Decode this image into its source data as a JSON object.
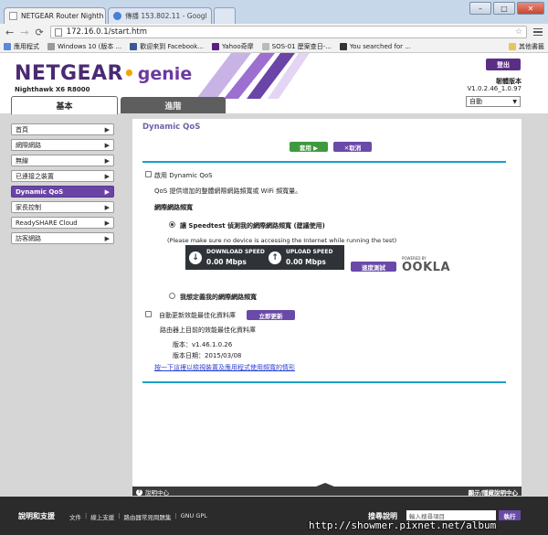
{
  "browser": {
    "tabs": [
      {
        "title": "NETGEAR Router Nighth",
        "close": "×",
        "icon_color": "#ffffff"
      },
      {
        "title": "傳播 153.802.11 - Googl",
        "close": "×",
        "icon_color": "#4a7fd8"
      }
    ],
    "window_buttons": {
      "minimize": "–",
      "maximize": "□",
      "close": "✕"
    },
    "url": "172.16.0.1/start.htm",
    "bookmarks": [
      {
        "label": "應用程式",
        "icon_color": "#5a8bd8"
      },
      {
        "label": "Windows 10 (版本 ...",
        "icon_color": "#9a9a9a"
      },
      {
        "label": "歡迎來到 Facebook...",
        "icon_color": "#3b5998"
      },
      {
        "label": "Yahoo奇摩",
        "icon_color": "#5b1e86"
      },
      {
        "label": "SOS-01 歷案查日-...",
        "icon_color": "#bbbbbb"
      },
      {
        "label": "You searched for ...",
        "icon_color": "#333333"
      }
    ],
    "other_bookmarks": "其他書籤"
  },
  "router": {
    "brand": "NETGEAR",
    "product": "genie",
    "model": "Nighthawk X6 R8000",
    "logout": "登出",
    "firmware_label": "韌體版本",
    "firmware_version": "V1.0.2.46_1.0.97",
    "language": "自動",
    "tabs": {
      "basic": "基本",
      "advanced": "進階"
    }
  },
  "sidebar": {
    "items": [
      {
        "label": "首頁"
      },
      {
        "label": "網際網路"
      },
      {
        "label": "無線"
      },
      {
        "label": "已連接之裝置"
      },
      {
        "label": "Dynamic QoS"
      },
      {
        "label": "家長控制"
      },
      {
        "label": "ReadySHARE Cloud"
      },
      {
        "label": "訪客網路"
      }
    ],
    "active_index": 4,
    "chevron": "▶"
  },
  "page": {
    "title": "Dynamic QoS",
    "apply": "套用 ▶",
    "cancel": "✕取消",
    "enable_qos": "啟用 Dynamic QoS",
    "qos_desc": "QoS 提供增加的整體網際網路頻寬或 WiFi 頻寬量。",
    "bandwidth_heading": "網際網路頻寬",
    "speedtest_option": "讓 Speedtest 偵測我的網際網路頻寬 (建議使用)",
    "speedtest_note": "(Please make sure no device is accessing the Internet while running the test)",
    "download_label": "DOWNLOAD SPEED",
    "download_value": "0.00 Mbps",
    "upload_label": "UPLOAD SPEED",
    "upload_value": "0.00 Mbps",
    "speed_test_button": "速度測試",
    "powered_by": "POWERED BY",
    "ookla": "OOKLA",
    "manual_option": "我想定義我的網際網路頻寬",
    "auto_update": "自動更新效能最佳化資料庫",
    "update_now": "立即更新",
    "db_desc": "路由器上目前的效能最佳化資料庫",
    "version_line": "版本：v1.46.1.0.26",
    "date_line": "版本日期：2015/03/08",
    "view_devices_link": "按一下這裡以檢視裝置及應用程式使用頻寬的情形",
    "footer_help": "說明中心",
    "footer_toggle": "顯示/隱藏說明中心"
  },
  "footer": {
    "title": "說明和支援",
    "links": [
      "文件",
      "線上支援",
      "路由器常見問題集",
      "GNU GPL"
    ],
    "search_label": "搜尋說明",
    "search_placeholder": "輸入搜尋項目",
    "search_button": "執行"
  },
  "watermark": "http://showmer.pixnet.net/album",
  "colors": {
    "brand_purple": "#5b2e86",
    "accent_blue": "#1a9fc7",
    "apply_green": "#3f9a3f"
  }
}
